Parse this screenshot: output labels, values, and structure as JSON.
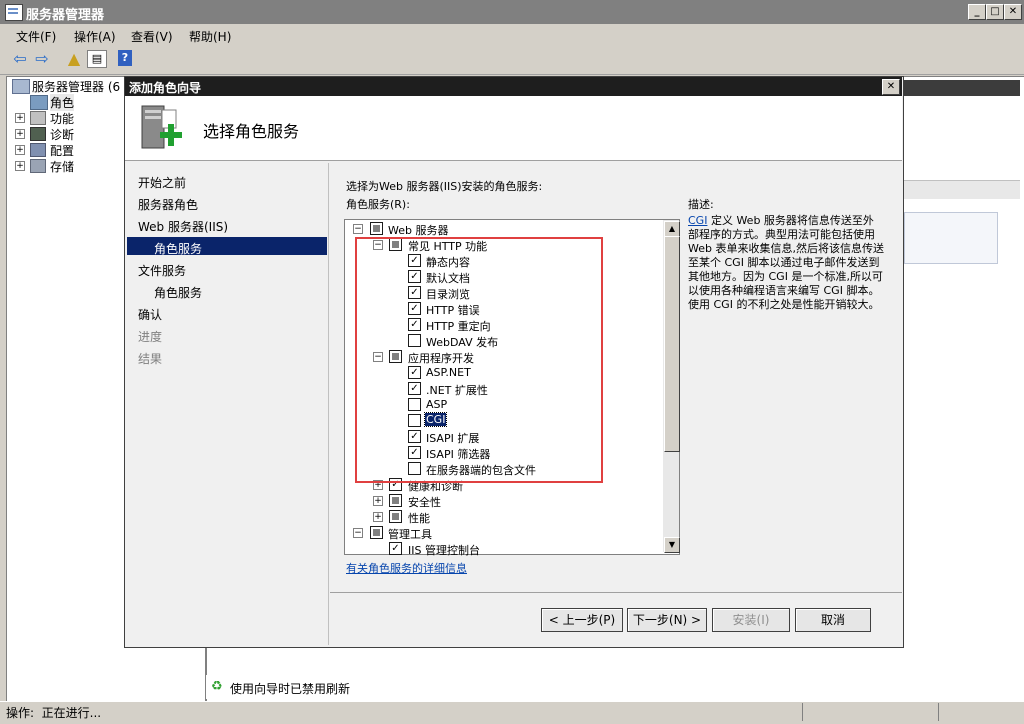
{
  "app": {
    "title": "服务器管理器",
    "window_controls": {
      "minimize": "_",
      "maximize": "□",
      "close": "✕"
    },
    "menu": [
      "文件(F)",
      "操作(A)",
      "查看(V)",
      "帮助(H)"
    ],
    "toolbar_icons": [
      "back-arrow-icon",
      "forward-arrow-icon",
      "up-folder-icon",
      "show-hide-tree-icon",
      "help-icon"
    ],
    "tree": {
      "root": "服务器管理器 (6",
      "items": [
        {
          "label": "角色",
          "icon": "roles-icon",
          "expandable": false
        },
        {
          "label": "功能",
          "icon": "features-icon",
          "expandable": true
        },
        {
          "label": "诊断",
          "icon": "diagnostics-icon",
          "expandable": true
        },
        {
          "label": "配置",
          "icon": "configuration-icon",
          "expandable": true
        },
        {
          "label": "存储",
          "icon": "storage-icon",
          "expandable": true
        }
      ]
    },
    "bottom_status": "使用向导时已禁用刷新",
    "statusbar": "操作:  正在进行..."
  },
  "dialog": {
    "title": "添加角色向导",
    "close": "✕",
    "banner_title": "选择角色服务",
    "nav": [
      {
        "label": "开始之前",
        "level": 0,
        "state": "normal"
      },
      {
        "label": "服务器角色",
        "level": 0,
        "state": "normal"
      },
      {
        "label": "Web 服务器(IIS)",
        "level": 0,
        "state": "normal"
      },
      {
        "label": "角色服务",
        "level": 1,
        "state": "selected"
      },
      {
        "label": "文件服务",
        "level": 0,
        "state": "normal"
      },
      {
        "label": "角色服务",
        "level": 1,
        "state": "normal"
      },
      {
        "label": "确认",
        "level": 0,
        "state": "normal"
      },
      {
        "label": "进度",
        "level": 0,
        "state": "disabled"
      },
      {
        "label": "结果",
        "level": 0,
        "state": "disabled"
      }
    ],
    "instruction": "选择为Web 服务器(IIS)安装的角色服务:",
    "list_label": "角色服务(R):",
    "tree_rows": [
      {
        "label": "Web 服务器",
        "level": 0,
        "expander": "-",
        "state": "partial"
      },
      {
        "label": "常见 HTTP 功能",
        "level": 1,
        "expander": "-",
        "state": "partial"
      },
      {
        "label": "静态内容",
        "level": 2,
        "expander": "",
        "state": "checked"
      },
      {
        "label": "默认文档",
        "level": 2,
        "expander": "",
        "state": "checked"
      },
      {
        "label": "目录浏览",
        "level": 2,
        "expander": "",
        "state": "checked"
      },
      {
        "label": "HTTP 错误",
        "level": 2,
        "expander": "",
        "state": "checked"
      },
      {
        "label": "HTTP 重定向",
        "level": 2,
        "expander": "",
        "state": "checked"
      },
      {
        "label": "WebDAV 发布",
        "level": 2,
        "expander": "",
        "state": "unchecked"
      },
      {
        "label": "应用程序开发",
        "level": 1,
        "expander": "-",
        "state": "partial"
      },
      {
        "label": "ASP.NET",
        "level": 2,
        "expander": "",
        "state": "checked"
      },
      {
        "label": ".NET 扩展性",
        "level": 2,
        "expander": "",
        "state": "checked"
      },
      {
        "label": "ASP",
        "level": 2,
        "expander": "",
        "state": "unchecked"
      },
      {
        "label": "CGI",
        "level": 2,
        "expander": "",
        "state": "unchecked",
        "highlight": true
      },
      {
        "label": "ISAPI 扩展",
        "level": 2,
        "expander": "",
        "state": "checked"
      },
      {
        "label": "ISAPI 筛选器",
        "level": 2,
        "expander": "",
        "state": "checked"
      },
      {
        "label": "在服务器端的包含文件",
        "level": 2,
        "expander": "",
        "state": "unchecked"
      },
      {
        "label": "健康和诊断",
        "level": 1,
        "expander": "+",
        "state": "checked"
      },
      {
        "label": "安全性",
        "level": 1,
        "expander": "+",
        "state": "partial"
      },
      {
        "label": "性能",
        "level": 1,
        "expander": "+",
        "state": "partial"
      },
      {
        "label": "管理工具",
        "level": 0,
        "expander": "-",
        "state": "partial"
      },
      {
        "label": "IIS 管理控制台",
        "level": 1,
        "expander": "",
        "state": "checked"
      }
    ],
    "details_link": "有关角色服务的详细信息",
    "description_label": "描述:",
    "description_link": "CGI",
    "description_text": "定义 Web 服务器将信息传送至外部程序的方式。典型用法可能包括使用 Web 表单来收集信息,然后将该信息传送至某个 CGI 脚本以通过电子邮件发送到其他地方。因为 CGI 是一个标准,所以可以使用各种编程语言来编写 CGI 脚本。使用 CGI 的不利之处是性能开销较大。",
    "buttons": {
      "prev": "< 上一步(P)",
      "next": "下一步(N) >",
      "install": "安装(I)",
      "cancel": "取消"
    },
    "colors": {
      "selection": "#0a246a",
      "highlight_box": "#e04040",
      "link": "#0645ad"
    }
  }
}
